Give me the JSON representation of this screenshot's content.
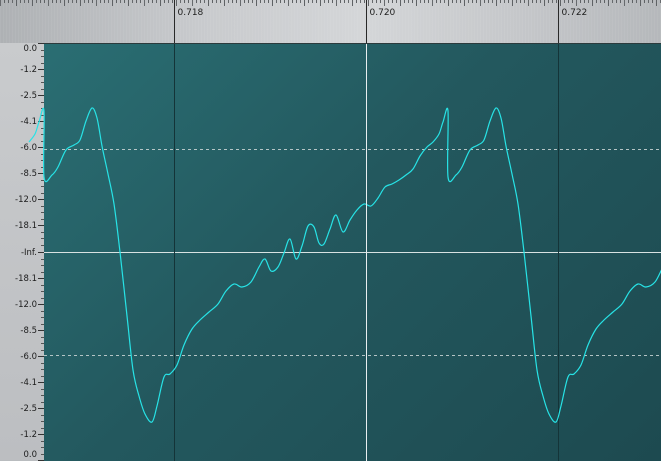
{
  "timeline": {
    "markers": [
      {
        "label": "0.718",
        "t": 0.718
      },
      {
        "label": "0.720",
        "t": 0.72
      },
      {
        "label": "0.722",
        "t": 0.722
      }
    ]
  },
  "db_scale": {
    "labels": [
      "0.0",
      "-1.2",
      "-2.5",
      "-4.1",
      "-6.0",
      "-8.5",
      "-12.0",
      "-18.1",
      "-Inf.",
      "-18.1",
      "-12.0",
      "-8.5",
      "-6.0",
      "-4.1",
      "-2.5",
      "-1.2",
      "0.0"
    ]
  },
  "colors": {
    "waveform": "#27e3e6",
    "cursor": "#e8eef0",
    "grid_dashed": "#cfd8d8"
  },
  "waveform": {
    "channel": "mono",
    "period_ms": 0.003
  }
}
